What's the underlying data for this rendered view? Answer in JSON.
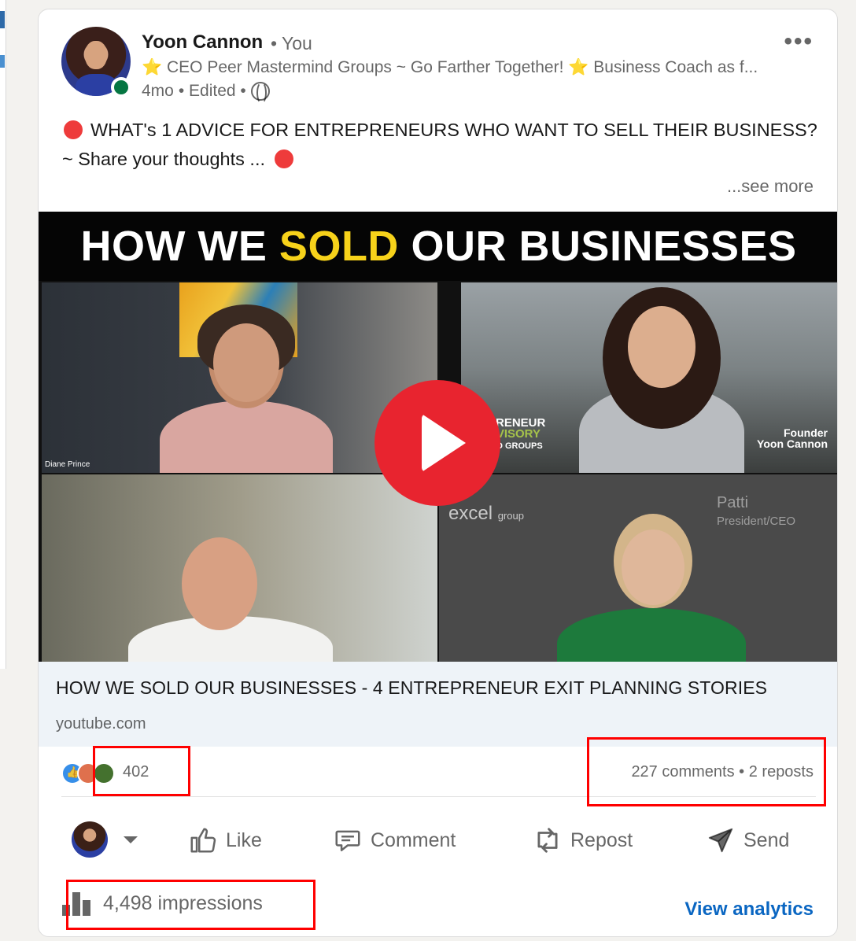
{
  "post": {
    "author": "Yoon Cannon",
    "author_suffix": "• You",
    "headline_star": "⭐",
    "headline": "CEO Peer Mastermind Groups ~ Go Farther Together!",
    "headline_star2": "⭐",
    "headline_rest": "Business Coach as f...",
    "time": "4mo",
    "edited": "• Edited •",
    "text_line1": "WHAT's 1 ADVICE FOR ENTREPRENEURS WHO WANT TO SELL THEIR BUSINESS?",
    "text_line2": "~ Share your thoughts ...",
    "see_more": "...see more",
    "more_menu": "•••"
  },
  "video": {
    "banner_part1": "HOW WE ",
    "banner_highlight": "SOLD",
    "banner_part2": " OUR BUSINESSES",
    "accent_color": "#f7d21a",
    "play_color": "#e8242f",
    "label_diane": "Diane Prince",
    "label_founder": "Founder",
    "label_founder_name": "Yoon Cannon",
    "logo_line1": "PRENEUR",
    "logo_line2": "DVISORY",
    "logo_line3": "IND GROUPS",
    "excel": "excel",
    "excel_group": "group",
    "patti_name": "Patti",
    "patti_role": "President/CEO"
  },
  "link": {
    "title": "HOW WE SOLD OUR BUSINESSES - 4 ENTREPRENEUR EXIT PLANNING STORIES",
    "source": "youtube.com"
  },
  "social": {
    "reactions": [
      "like",
      "love",
      "celebrate"
    ],
    "reaction_count": "402",
    "comments_reposts": "227 comments • 2 reposts"
  },
  "actions": {
    "like": "Like",
    "comment": "Comment",
    "repost": "Repost",
    "send": "Send"
  },
  "analytics": {
    "impressions": "4,498 impressions",
    "view_analytics": "View analytics",
    "link_color": "#0a66c2"
  },
  "highlight_color": "#ff0000"
}
